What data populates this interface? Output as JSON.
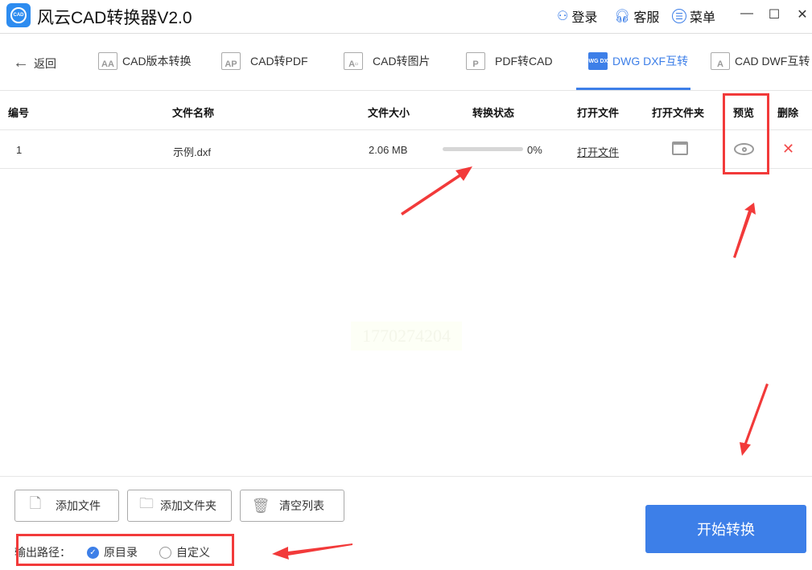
{
  "app": {
    "title": "风云CAD转换器V2.0",
    "logo_text": "CAD"
  },
  "titlebar": {
    "login": "登录",
    "service": "客服",
    "menu": "菜单",
    "minimize": "—",
    "maximize": "☐",
    "close": "✕"
  },
  "nav": {
    "back": "返回",
    "tabs": [
      {
        "label": "CAD版本转换",
        "icon": "AA"
      },
      {
        "label": "CAD转PDF",
        "icon": "AP"
      },
      {
        "label": "CAD转图片",
        "icon": "A▫"
      },
      {
        "label": "PDF转CAD",
        "icon": "P"
      },
      {
        "label": "DWG DXF互转",
        "icon": "DWG DXF",
        "active": true
      },
      {
        "label": "CAD DWF互转",
        "icon": "A"
      }
    ]
  },
  "table": {
    "headers": [
      "编号",
      "文件名称",
      "文件大小",
      "转换状态",
      "打开文件",
      "打开文件夹",
      "预览",
      "删除"
    ],
    "rows": [
      {
        "index": "1",
        "name": "示例.dxf",
        "size": "2.06 MB",
        "progress_percent": 0,
        "progress_text": "0%",
        "open_file": "打开文件"
      }
    ]
  },
  "watermark": "1770274204",
  "footer": {
    "add_file": "添加文件",
    "add_folder": "添加文件夹",
    "clear_list": "清空列表",
    "output_label": "输出路径：",
    "option_original": "原目录",
    "option_custom": "自定义",
    "start": "开始转换"
  },
  "colors": {
    "accent": "#3d7fe8",
    "annotation": "#f23a3a"
  }
}
